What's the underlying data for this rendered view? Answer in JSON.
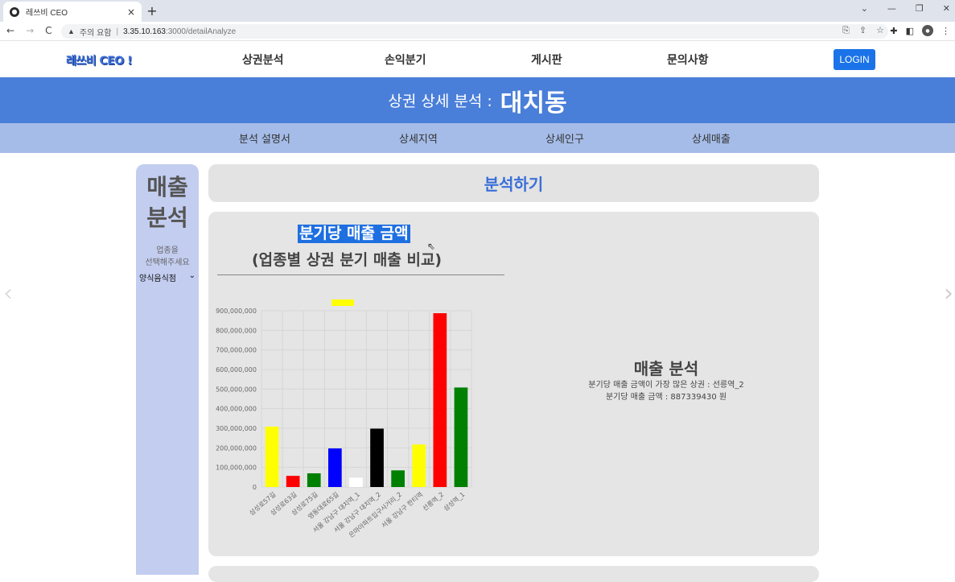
{
  "browser": {
    "tab_title": "레쓰비 CEO",
    "tab_close": "×",
    "new_tab": "+",
    "security_label": "주의 요함",
    "url_host": "3.35.10.163",
    "url_path": ":3000/detailAnalyze",
    "nav": [
      "←",
      "→",
      "C"
    ],
    "window_controls": [
      "⌄",
      "—",
      "❐",
      "✕"
    ]
  },
  "site": {
    "logo": "레쓰비 CEO !",
    "nav": [
      "상권분석",
      "손익분기",
      "게시판",
      "문의사항"
    ],
    "login": "LOGIN"
  },
  "banner": {
    "label": "상권 상세 분석 :",
    "district": "대치동"
  },
  "subnav": [
    "분석 설명서",
    "상세지역",
    "상세인구",
    "상세매출"
  ],
  "sidebar": {
    "title_line1": "매출",
    "title_line2": "분석",
    "hint_line1": "업종을",
    "hint_line2": "선택해주세요",
    "selected": "양식음식점"
  },
  "main": {
    "heading": "분석하기",
    "chart_title1": "분기당 매출 금액",
    "chart_title2": "(업종별 상권 분기 매출 비교)"
  },
  "summary": {
    "title": "매출 분석",
    "line1": "분기당 매출 금액이 가장 많은 상권 : 선릉역_2",
    "line2": "분기당 매출 금액 : 887339430 원"
  },
  "chart_data": {
    "type": "bar",
    "categories": [
      "삼성로57길",
      "삼성로63길",
      "삼성로75길",
      "영동대로65길",
      "서울 강남구 대치역_1",
      "서울 강남구 대치역_2",
      "은마아파트입구사거리_2",
      "서울 강남구 한티역",
      "선릉역_2",
      "삼성역_1"
    ],
    "values": [
      308000000,
      57000000,
      70000000,
      197000000,
      48000000,
      298000000,
      85000000,
      217000000,
      887339430,
      508000000
    ],
    "colors": [
      "#ffff00",
      "#ff0000",
      "#008000",
      "#0000ff",
      "#ffffff",
      "#000000",
      "#008000",
      "#ffff00",
      "#ff0000",
      "#008000"
    ],
    "ylim": [
      0,
      900000000
    ],
    "yticks": [
      "0",
      "100,000,000",
      "200,000,000",
      "300,000,000",
      "400,000,000",
      "500,000,000",
      "600,000,000",
      "700,000,000",
      "800,000,000",
      "900,000,000"
    ],
    "grid": true,
    "legend": "top"
  }
}
